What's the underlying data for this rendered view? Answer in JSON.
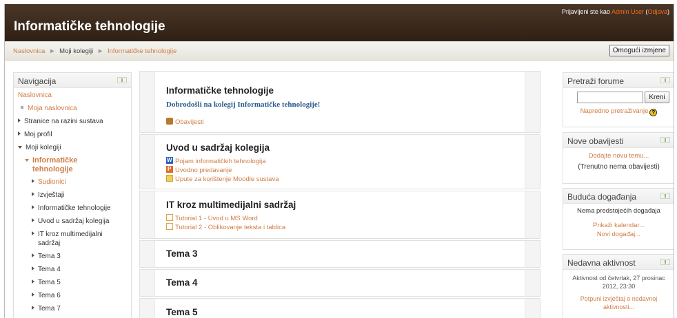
{
  "header": {
    "site_title": "Informatičke tehnologije",
    "login_prefix": "Prijavljeni ste kao",
    "user": "Admin User",
    "open_paren": " (",
    "logout": "Odjava",
    "close_paren": ")"
  },
  "breadcrumb": {
    "items": [
      "Naslovnica",
      "Moji kolegiji",
      "Informatičke tehnologije"
    ],
    "separator": "►"
  },
  "edit_button": "Omogući izmjene",
  "navigation": {
    "title": "Navigacija",
    "items": [
      {
        "label": "Naslovnica"
      },
      {
        "label": "Moja naslovnica"
      },
      {
        "label": "Stranice na razini sustava"
      },
      {
        "label": "Moj profil"
      },
      {
        "label": "Moji kolegiji"
      },
      {
        "label": "Informatičke tehnologije"
      },
      {
        "label": "Sudionici"
      },
      {
        "label": "Izvještaji"
      },
      {
        "label": "Informatičke tehnologije"
      },
      {
        "label": "Uvod u sadržaj kolegija"
      },
      {
        "label": "IT kroz multimedijalni sadržaj"
      },
      {
        "label": "Tema 3"
      },
      {
        "label": "Tema 4"
      },
      {
        "label": "Tema 5"
      },
      {
        "label": "Tema 6"
      },
      {
        "label": "Tema 7"
      }
    ]
  },
  "sections": [
    {
      "title": "Informatičke tehnologije",
      "welcome": "Dobrodošli na kolegij Informatičke tehnologije!",
      "activities": [
        {
          "label": "Obavijesti",
          "icon": "forum-icon"
        }
      ]
    },
    {
      "title": "Uvod u sadržaj kolegija",
      "activities": [
        {
          "label": "Pojam informatičkih tehnologija",
          "icon": "word-doc-icon"
        },
        {
          "label": "Uvodno predavanje",
          "icon": "powerpoint-icon"
        },
        {
          "label": "Upute za korištenje Moodle sustava",
          "icon": "folder-icon"
        }
      ]
    },
    {
      "title": "IT kroz multimedijalni sadržaj",
      "activities": [
        {
          "label": "Tutorial 1 - Uvod u MS Word",
          "icon": "page-icon"
        },
        {
          "label": "Tutorial 2 - Oblikovanje teksta i tablica",
          "icon": "page-icon"
        }
      ]
    },
    {
      "title": "Tema 3"
    },
    {
      "title": "Tema 4"
    },
    {
      "title": "Tema 5"
    }
  ],
  "search_forums": {
    "title": "Pretraži forume",
    "input_value": "",
    "button": "Kreni",
    "advanced": "Napredno pretraživanje"
  },
  "news": {
    "title": "Nove obavijesti",
    "add": "Dodajte novu temu...",
    "none": "(Trenutno nema obavijesti)"
  },
  "upcoming": {
    "title": "Buduća događanja",
    "none": "Nema predstojećih događaja",
    "calendar": "Prikaži kalendar...",
    "new_event": "Novi događaj..."
  },
  "recent": {
    "title": "Nedavna aktivnost",
    "since_line1": "Aktivnost od četvrtak, 27 prosinac",
    "since_line2": "2012, 23:30",
    "full_line1": "Potpuni izvještaj o nedavnoj",
    "full_line2": "aktivnosti..."
  }
}
